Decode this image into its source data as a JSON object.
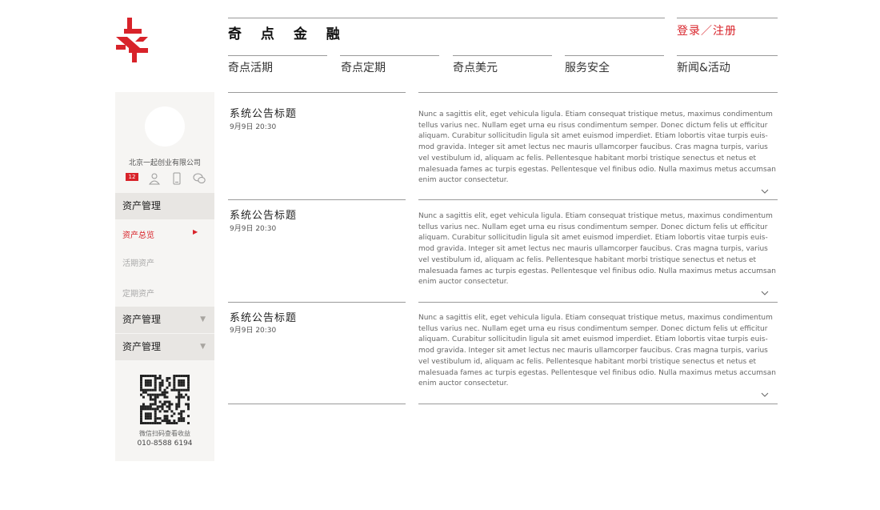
{
  "header": {
    "brand": "奇 点 金 融",
    "login": "登录／注册",
    "nav": [
      "奇点活期",
      "奇点定期",
      "奇点美元",
      "服务安全",
      "新闻&活动"
    ]
  },
  "sidebar": {
    "company": "北京一起创业有限公司",
    "badge_count": "12",
    "icons": [
      "user-icon",
      "phone-icon",
      "wechat-icon"
    ],
    "menu": {
      "section1": "资产管理",
      "sub_active": "资产总览",
      "sub2": "活期资产",
      "sub3": "定期资产",
      "section2": "资产管理",
      "section3": "资产管理"
    },
    "qr_caption": "微信扫码查看收益",
    "phone": "010-8588 6194"
  },
  "colors": {
    "accent": "#d8232a",
    "sidebar_bg": "#f6f5f3",
    "menu_head_bg": "#e8e6e3"
  },
  "news": [
    {
      "title": "系统公告标题",
      "date": "9月9日  20:30",
      "lines": [
        "Nunc a sagittis elit, eget vehicula ligula. Etiam consequat tristique metus, maximus condimentum",
        "tellus varius nec. Nullam eget urna eu risus condimentum semper. Donec dictum felis ut efficitur",
        "aliquam. Curabitur sollicitudin ligula sit amet euismod imperdiet. Etiam lobortis vitae turpis euis-",
        "mod gravida. Integer sit amet lectus nec mauris ullamcorper faucibus. Cras magna turpis, varius",
        "vel vestibulum id, aliquam ac felis. Pellentesque habitant morbi tristique senectus et netus et",
        "malesuada fames ac turpis egestas. Pellentesque vel finibus odio. Nulla maximus metus accumsan",
        "enim auctor consectetur."
      ]
    },
    {
      "title": "系统公告标题",
      "date": "9月9日  20:30",
      "lines": [
        "Nunc a sagittis elit, eget vehicula ligula. Etiam consequat tristique metus, maximus condimentum",
        "tellus varius nec. Nullam eget urna eu risus condimentum semper. Donec dictum felis ut efficitur",
        "aliquam. Curabitur sollicitudin ligula sit amet euismod imperdiet. Etiam lobortis vitae turpis euis-",
        "mod gravida. Integer sit amet lectus nec mauris ullamcorper faucibus. Cras magna turpis, varius",
        "vel vestibulum id, aliquam ac felis. Pellentesque habitant morbi tristique senectus et netus et",
        "malesuada fames ac turpis egestas. Pellentesque vel finibus odio. Nulla maximus metus accumsan",
        "enim auctor consectetur."
      ]
    },
    {
      "title": "系统公告标题",
      "date": "9月9日  20:30",
      "lines": [
        "Nunc a sagittis elit, eget vehicula ligula. Etiam consequat tristique metus, maximus condimentum",
        "tellus varius nec. Nullam eget urna eu risus condimentum semper. Donec dictum felis ut efficitur",
        "aliquam. Curabitur sollicitudin ligula sit amet euismod imperdiet. Etiam lobortis vitae turpis euis-",
        "mod gravida. Integer sit amet lectus nec mauris ullamcorper faucibus. Cras magna turpis, varius",
        "vel vestibulum id, aliquam ac felis. Pellentesque habitant morbi tristique senectus et netus et",
        "malesuada fames ac turpis egestas. Pellentesque vel finibus odio. Nulla maximus metus accumsan",
        "enim auctor consectetur."
      ]
    }
  ]
}
